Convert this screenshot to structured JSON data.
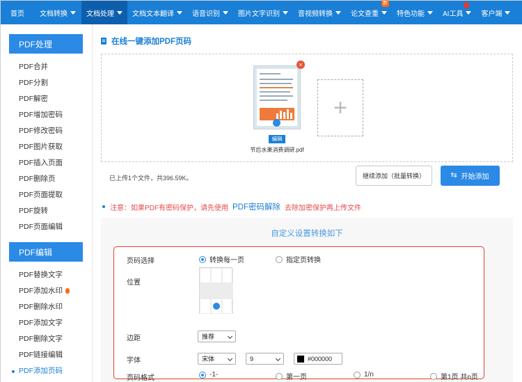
{
  "nav": {
    "items": [
      {
        "label": "首页",
        "caret": false
      },
      {
        "label": "文档转换",
        "caret": true
      },
      {
        "label": "文档处理",
        "caret": true
      },
      {
        "label": "文档文本翻译",
        "caret": true
      },
      {
        "label": "语音识别",
        "caret": true
      },
      {
        "label": "图片文字识别",
        "caret": true
      },
      {
        "label": "音视频转换",
        "caret": true
      },
      {
        "label": "论文查重",
        "caret": true,
        "badge": "新"
      },
      {
        "label": "特色功能",
        "caret": true
      },
      {
        "label": "AI工具",
        "caret": true
      },
      {
        "label": "客户端",
        "caret": true
      }
    ]
  },
  "sidebar": {
    "section1": {
      "title": "PDF处理",
      "items": [
        "PDF合并",
        "PDF分割",
        "PDF解密",
        "PDF增加密码",
        "PDF修改密码",
        "PDF图片获取",
        "PDF插入页面",
        "PDF删除页",
        "PDF页面提取",
        "PDF旋转",
        "PDF页面编辑"
      ]
    },
    "section2": {
      "title": "PDF编辑",
      "items": [
        "PDF替换文字",
        "PDF添加水印",
        "PDF删除水印",
        "PDF添加文字",
        "PDF删除文字",
        "PDF链接编辑",
        "PDF添加页码"
      ]
    }
  },
  "main": {
    "title": "在线一键添加PDF页码",
    "file": {
      "name": "节后水果消费调研.pdf",
      "edit_label": "编辑",
      "close": "×"
    },
    "add_symbol": "+",
    "upload_info": "已上传1个文件，共396.59K。",
    "continue_label": "继续添加（批量转换）",
    "start_label": "开始添加",
    "notice": {
      "prefix": "注意：如果PDF有密码保护，请先使用",
      "link": "PDF密码解除",
      "suffix": "去除加密保护再上传文件"
    }
  },
  "settings": {
    "title": "自定义设置转换如下",
    "page_select": {
      "label": "页码选择",
      "options": [
        "转换每一页",
        "指定页转换"
      ],
      "selected": 0
    },
    "position": {
      "label": "位置"
    },
    "margin": {
      "label": "边距",
      "value": "推荐"
    },
    "font": {
      "label": "字体",
      "family": "宋体",
      "size": "9",
      "color": "#000000"
    },
    "format": {
      "label": "页码格式",
      "options": [
        "-1-",
        "第一页",
        "1/n",
        "第1页 共n页"
      ],
      "selected": 0
    }
  },
  "colors": {
    "nav": "#1a7fd6",
    "nav_active": "#0d5fae",
    "accent": "#2b8ae6",
    "alert": "#e84a4a",
    "settings_border": "#e0412f"
  }
}
